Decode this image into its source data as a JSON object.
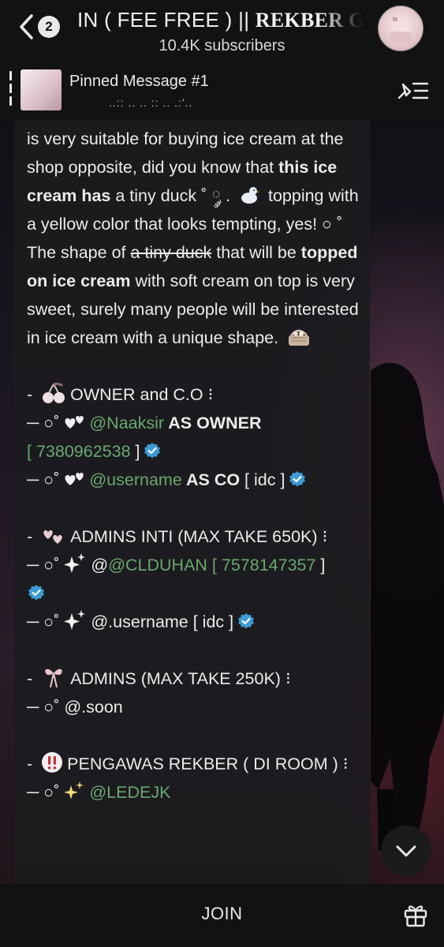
{
  "header": {
    "unread_count": "2",
    "title_main": "IN ( FEE FREE ) || ",
    "title_serif": "REKBER G",
    "subscribers": "10.4K subscribers",
    "avatar_icon": "channel-avatar"
  },
  "pinned": {
    "title": "Pinned Message #1",
    "preview": "..:: ..      .. :: ..      .:'.."
  },
  "message": {
    "p1_a": "is very suitable for buying ice cream at the shop opposite, did you know that ",
    "p1_b": "this ice cream has",
    "p1_c": " a tiny duck ˚ ༘ . ",
    "p1_d": " topping with a yellow color that looks tempting, yes! ○ ˚ The shape of ",
    "p1_e": "a tiny duck",
    "p1_f": " that will be ",
    "p1_g": "topped on ice cream",
    "p1_h": " with soft cream on top is very sweet, surely many people will be interested in ice cream with a unique shape. ",
    "owner_heading": "OWNER and C.O ⁝",
    "owner_line_prefix": "─ ○˚",
    "owner_handle": "@Naaksir",
    "owner_role": " AS OWNER",
    "owner_id_open": "[ ",
    "owner_id": "7380962538",
    "owner_id_close": " ]",
    "co_handle": "@username",
    "co_role": " AS CO  ",
    "co_tag": "[ idc ]",
    "admins_inti_heading": "ADMINS INTI (MAX TAKE 650K) ⁝",
    "admin1_handle_prefix": "@",
    "admin1_handle": "@CLDUHAN",
    "admin1_id_open": " [ ",
    "admin1_id": "7578147357",
    "admin1_id_close": " ]",
    "admin2_handle": "@.username [ idc ]",
    "admins_heading": "ADMINS (MAX TAKE 250K) ⁝",
    "admins_soon": "@.soon",
    "pengawas_heading": "PENGAWAS REKBER ( DI ROOM ) ⁝",
    "pengawas_handle": "@LEDEJK",
    "dash": "- ",
    "line_prefix": "─ ○˚"
  },
  "bottom": {
    "join_label": "JOIN"
  },
  "colors": {
    "link": "#6aa86f",
    "verified": "#3e9bd6",
    "background": "#121212"
  }
}
